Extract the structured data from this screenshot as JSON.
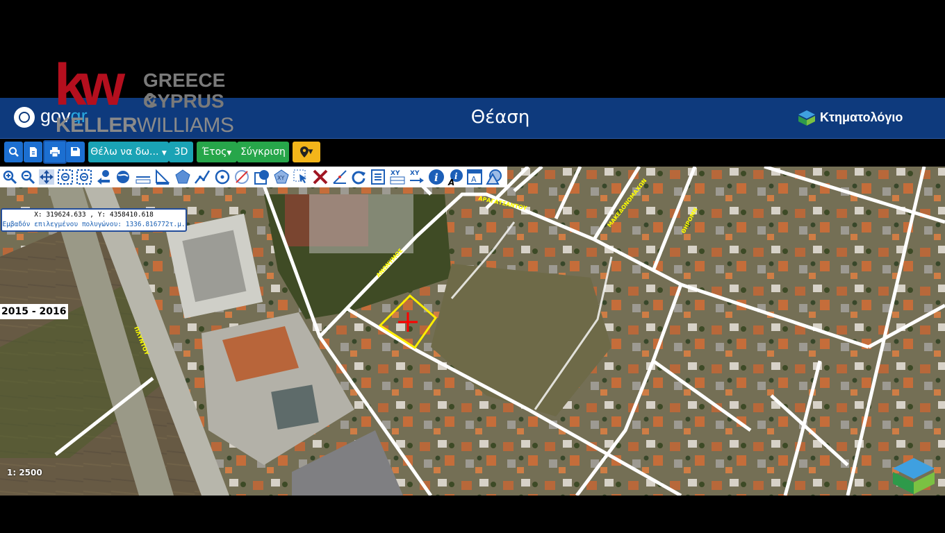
{
  "branding": {
    "kw_mark": "kw",
    "kw_region_line1": "GREECE &",
    "kw_region_line2": "CYPRUS",
    "kw_name_bold": "KELLER",
    "kw_name_light": "WILLIAMS"
  },
  "header": {
    "gov_prefix": "gov",
    "gov_suffix": "gr",
    "title": "Θέαση",
    "brand": "Κτηματολόγιο"
  },
  "toolbar": {
    "view_dropdown": "Θέλω να δω...",
    "three_d": "3D",
    "year_dropdown": "Έτος",
    "compare": "Σύγκριση"
  },
  "coords": {
    "xy": "X: 319624.633 , Y: 4358410.618",
    "area": "Εμβαδόν επιλεγμένου πολυγώνου: 1336.816772τ.μ."
  },
  "map": {
    "year_range": "2015 - 2016",
    "scale": "1: 2500",
    "street_labels": [
      "ΑΡΑΓΑΤΣΑΝΤΟΥ",
      "ΜΑΚΕΔΟΝΟΜΑΧΩΝ",
      "ΘΗΡΟΜΝ",
      "ΑΝΩΝΥΜΟΣ",
      "ΠΛΥΝΤΟΥ"
    ]
  },
  "colors": {
    "header_bg": "#0e3a7d",
    "selection": "#ffee00",
    "marker": "#ff0000"
  }
}
